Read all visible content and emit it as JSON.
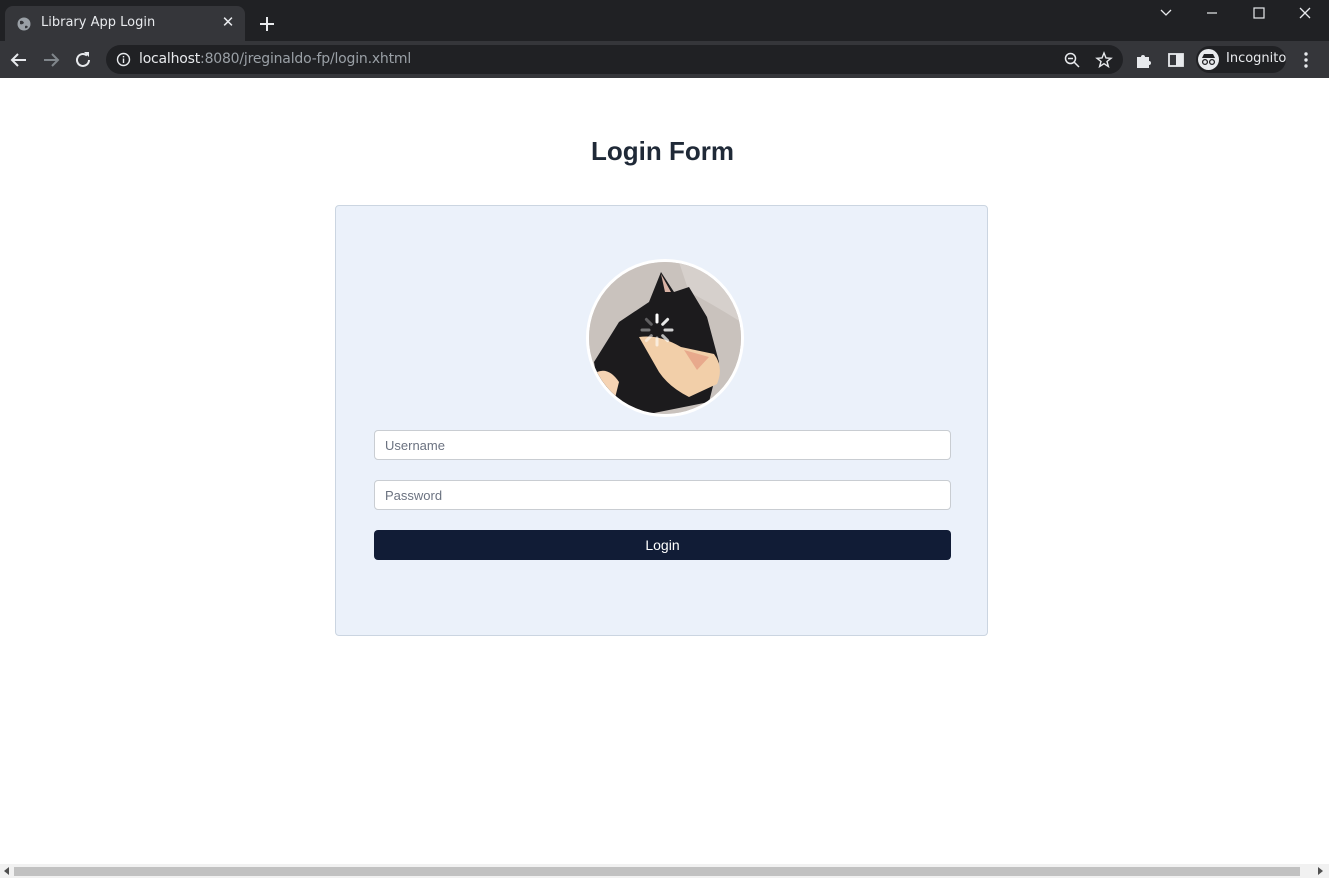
{
  "browser": {
    "tab_title": "Library App Login",
    "url_host": "localhost",
    "url_rest": ":8080/jreginaldo-fp/login.xhtml",
    "profile_label": "Incognito",
    "icons": [
      "globe-icon",
      "close-icon",
      "plus-icon",
      "chevron-down-icon",
      "minimize-icon",
      "maximize-icon",
      "close-window-icon",
      "back-icon",
      "forward-icon",
      "reload-icon",
      "info-icon",
      "zoom-icon",
      "star-icon",
      "puzzle-icon",
      "side-panel-icon",
      "incognito-icon",
      "kebab-menu-icon"
    ]
  },
  "page": {
    "title": "Login Form",
    "username_placeholder": "Username",
    "password_placeholder": "Password",
    "login_label": "Login",
    "accent_color": "#111c36",
    "card_background": "#ebf1fa"
  }
}
